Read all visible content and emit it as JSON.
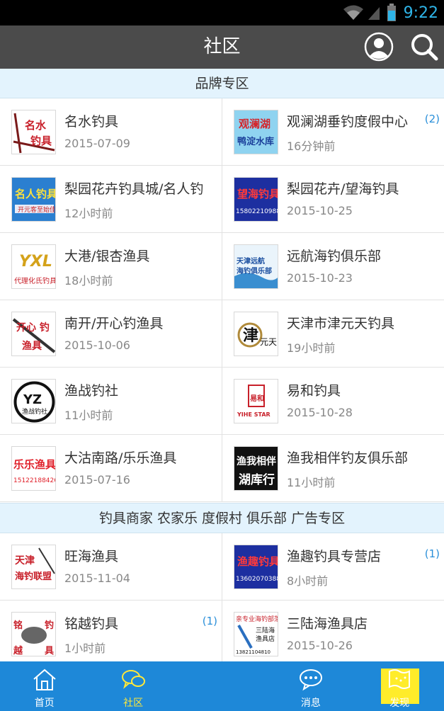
{
  "status_bar": {
    "time": "9:22"
  },
  "header": {
    "title": "社区"
  },
  "sections": [
    {
      "title": "品牌专区",
      "rows": [
        [
          {
            "name": "名水钓具",
            "meta": "2015-07-09",
            "badge": "",
            "thumb_text": "名水钓具"
          },
          {
            "name": "观澜湖垂钓度假中心",
            "meta": "16分钟前",
            "badge": "(2)",
            "thumb_text": "观澜湖 鸭淀水库"
          }
        ],
        [
          {
            "name": "梨园花卉钓具城/名人钓",
            "meta": "12小时前",
            "badge": "",
            "thumb_text": "名人钓具"
          },
          {
            "name": "梨园花卉/望海钓具",
            "meta": "2015-10-25",
            "badge": "",
            "thumb_text": "望海钓具 15802210988"
          }
        ],
        [
          {
            "name": "大港/银杏渔具",
            "meta": "18小时前",
            "badge": "",
            "thumb_text": "YXL 代理化氏钓具"
          },
          {
            "name": "远航海钓俱乐部",
            "meta": "2015-10-23",
            "badge": "",
            "thumb_text": "天津远航 海钓俱乐部"
          }
        ],
        [
          {
            "name": "南开/开心钓渔具",
            "meta": "2015-10-06",
            "badge": "",
            "thumb_text": "开心钓渔具"
          },
          {
            "name": "天津市津元天钓具",
            "meta": "19小时前",
            "badge": "",
            "thumb_text": "津元天"
          }
        ],
        [
          {
            "name": "渔战钓社",
            "meta": "11小时前",
            "badge": "",
            "thumb_text": "YZ 渔战钓社"
          },
          {
            "name": "易和钓具",
            "meta": "2015-10-28",
            "badge": "",
            "thumb_text": "易和 YIHE STAR"
          }
        ],
        [
          {
            "name": "大沽南路/乐乐渔具",
            "meta": "2015-07-16",
            "badge": "",
            "thumb_text": "乐乐渔具 15122188426"
          },
          {
            "name": "渔我相伴钓友俱乐部",
            "meta": "11小时前",
            "badge": "",
            "thumb_text": "渔我相伴 湖库行"
          }
        ]
      ]
    },
    {
      "title": "钓具商家 农家乐 度假村 俱乐部 广告专区",
      "rows": [
        [
          {
            "name": "旺海渔具",
            "meta": "2015-11-04",
            "badge": "",
            "thumb_text": "天津 海钓联盟"
          },
          {
            "name": "渔趣钓具专营店",
            "meta": "8小时前",
            "badge": "(1)",
            "thumb_text": "渔趣钓具 13602070388"
          }
        ],
        [
          {
            "name": "铭越钓具",
            "meta": "1小时前",
            "badge": "(1)",
            "thumb_text": "铭 钓 越 具"
          },
          {
            "name": "三陆海渔具店",
            "meta": "2015-10-26",
            "badge": "",
            "thumb_text": "三陆海渔具店 13821104810"
          }
        ]
      ]
    }
  ],
  "bottom_nav": {
    "items": [
      {
        "label": "首页",
        "icon": "home-icon"
      },
      {
        "label": "社区",
        "icon": "chat-bubbles-icon"
      },
      {
        "label": "",
        "icon": "plus-icon"
      },
      {
        "label": "消息",
        "icon": "message-icon"
      },
      {
        "label": "发现",
        "icon": "map-flag-icon"
      }
    ]
  },
  "colors": {
    "header_bg": "#4b4b4b",
    "section_bg": "#e3f3fd",
    "nav_bg": "#1e88d8",
    "nav_active": "#ffe83a",
    "badge": "#2a8fd9",
    "status_time": "#2fb5e8"
  }
}
